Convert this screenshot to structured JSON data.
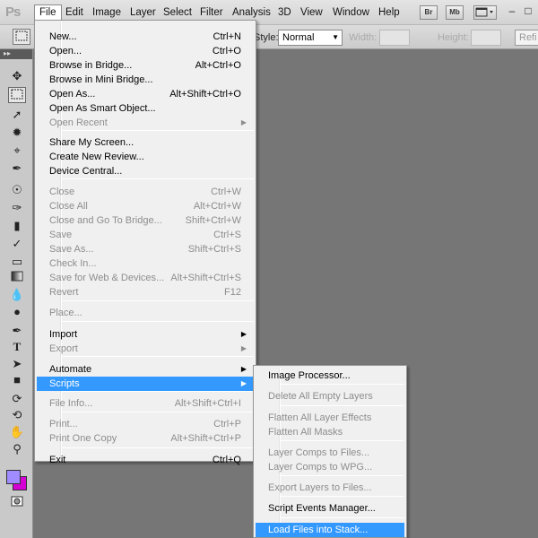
{
  "menubar": {
    "logo": "Ps",
    "items": [
      "File",
      "Edit",
      "Image",
      "Layer",
      "Select",
      "Filter",
      "Analysis",
      "3D",
      "View",
      "Window",
      "Help"
    ],
    "active": "File",
    "buttons": [
      "Br",
      "Mb"
    ]
  },
  "options": {
    "style_label": "Style:",
    "style_value": "Normal",
    "width_label": "Width:",
    "height_label": "Height:",
    "refine_label": "Refi"
  },
  "file_menu": {
    "items": [
      {
        "label": "New...",
        "shortcut": "Ctrl+N",
        "disabled": false
      },
      {
        "label": "Open...",
        "shortcut": "Ctrl+O",
        "disabled": false
      },
      {
        "label": "Browse in Bridge...",
        "shortcut": "Alt+Ctrl+O",
        "disabled": false
      },
      {
        "label": "Browse in Mini Bridge...",
        "shortcut": "",
        "disabled": false
      },
      {
        "label": "Open As...",
        "shortcut": "Alt+Shift+Ctrl+O",
        "disabled": false
      },
      {
        "label": "Open As Smart Object...",
        "shortcut": "",
        "disabled": false
      },
      {
        "label": "Open Recent",
        "shortcut": "",
        "disabled": true,
        "submenu": true
      },
      {
        "label": "Share My Screen...",
        "shortcut": "",
        "disabled": false
      },
      {
        "label": "Create New Review...",
        "shortcut": "",
        "disabled": false
      },
      {
        "label": "Device Central...",
        "shortcut": "",
        "disabled": false
      },
      {
        "label": "Close",
        "shortcut": "Ctrl+W",
        "disabled": true
      },
      {
        "label": "Close All",
        "shortcut": "Alt+Ctrl+W",
        "disabled": true
      },
      {
        "label": "Close and Go To Bridge...",
        "shortcut": "Shift+Ctrl+W",
        "disabled": true
      },
      {
        "label": "Save",
        "shortcut": "Ctrl+S",
        "disabled": true
      },
      {
        "label": "Save As...",
        "shortcut": "Shift+Ctrl+S",
        "disabled": true
      },
      {
        "label": "Check In...",
        "shortcut": "",
        "disabled": true
      },
      {
        "label": "Save for Web & Devices...",
        "shortcut": "Alt+Shift+Ctrl+S",
        "disabled": true
      },
      {
        "label": "Revert",
        "shortcut": "F12",
        "disabled": true
      },
      {
        "label": "Place...",
        "shortcut": "",
        "disabled": true
      },
      {
        "label": "Import",
        "shortcut": "",
        "disabled": false,
        "submenu": true
      },
      {
        "label": "Export",
        "shortcut": "",
        "disabled": true,
        "submenu": true
      },
      {
        "label": "Automate",
        "shortcut": "",
        "disabled": false,
        "submenu": true
      },
      {
        "label": "Scripts",
        "shortcut": "",
        "disabled": false,
        "submenu": true,
        "highlight": true
      },
      {
        "label": "File Info...",
        "shortcut": "Alt+Shift+Ctrl+I",
        "disabled": true
      },
      {
        "label": "Print...",
        "shortcut": "Ctrl+P",
        "disabled": true
      },
      {
        "label": "Print One Copy",
        "shortcut": "Alt+Shift+Ctrl+P",
        "disabled": true
      },
      {
        "label": "Exit",
        "shortcut": "Ctrl+Q",
        "disabled": false
      }
    ]
  },
  "scripts_menu": {
    "items": [
      {
        "label": "Image Processor...",
        "disabled": false
      },
      {
        "label": "Delete All Empty Layers",
        "disabled": true
      },
      {
        "label": "Flatten All Layer Effects",
        "disabled": true
      },
      {
        "label": "Flatten All Masks",
        "disabled": true
      },
      {
        "label": "Layer Comps to Files...",
        "disabled": true
      },
      {
        "label": "Layer Comps to WPG...",
        "disabled": true
      },
      {
        "label": "Export Layers to Files...",
        "disabled": true
      },
      {
        "label": "Script Events Manager...",
        "disabled": false
      },
      {
        "label": "Load Files into Stack...",
        "disabled": false,
        "highlight": true
      }
    ]
  },
  "colors": {
    "highlight": "#3399ff",
    "foreground_swatch": "#a08cff",
    "background_swatch": "#d400d4"
  }
}
